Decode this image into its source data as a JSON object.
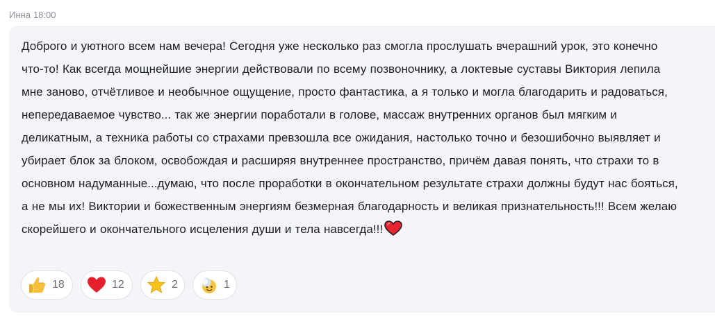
{
  "message": {
    "author": "Инна",
    "time": "18:00",
    "lines": [
      "Доброго и уютного всем нам вечера! Сегодня уже несколько раз смогла прослушать вчерашний урок, это конечно",
      "что-то! Как всегда мощнейшие энергии действовали по всему позвоночнику, а локтевые суставы Виктория лепила",
      "мне заново, отчётливое и необычное ощущение, просто фантастика, а я только и могла благодарить и радоваться,",
      "непередаваемое чувство... так же энергии поработали в голове, массаж внутренних органов был мягким и",
      "деликатным, а техника работы со страхами превзошла все ожидания, настолько точно и безошибочно выявляет и",
      "убирает блок за блоком, освобождая и расширяя внутреннее пространство, причём давая понять, что страхи то в",
      "основном надуманные...думаю, что после проработки в окончательном результате страхи должны будут нас бояться,",
      "а не мы их! Виктории и божественным энергиям безмерная благодарность и великая признательность!!! Всем желаю",
      "скорейшего и окончательного исцеления души и тела навсегда!!!"
    ],
    "trailing_emoji": "heart-emoji"
  },
  "reactions": [
    {
      "icon": "thumbs-up-icon",
      "count": "18"
    },
    {
      "icon": "heart-icon",
      "count": "12"
    },
    {
      "icon": "star-icon",
      "count": "2"
    },
    {
      "icon": "sun-face-icon",
      "count": "1"
    }
  ],
  "colors": {
    "bubble_bg": "#f3f5f8",
    "text": "#1c1d1f",
    "meta": "#8a8f98",
    "heart": "#e8232f",
    "star": "#f7c31a",
    "thumb": "#f5b82e"
  }
}
